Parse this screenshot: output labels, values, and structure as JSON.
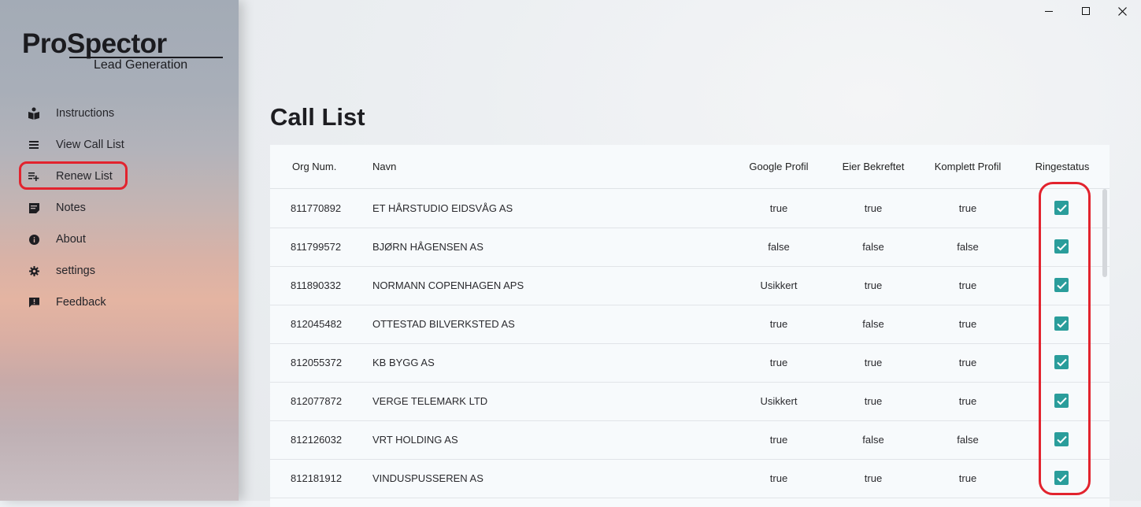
{
  "app": {
    "logo_title": "ProSpector",
    "logo_subtitle": "Lead Generation"
  },
  "sidebar": {
    "items": [
      {
        "label": "Instructions",
        "icon": "book-reader-icon"
      },
      {
        "label": "View Call List",
        "icon": "list-icon"
      },
      {
        "label": "Renew List",
        "icon": "playlist-add-icon"
      },
      {
        "label": "Notes",
        "icon": "note-icon"
      },
      {
        "label": "About",
        "icon": "info-icon"
      },
      {
        "label": "settings",
        "icon": "gear-icon"
      },
      {
        "label": "Feedback",
        "icon": "feedback-icon"
      }
    ]
  },
  "window": {
    "minimize": "minimize-icon",
    "maximize": "maximize-icon",
    "close": "close-icon"
  },
  "main": {
    "title": "Call List",
    "columns": [
      "Org Num.",
      "Navn",
      "Google Profil",
      "Eier Bekreftet",
      "Komplett Profil",
      "Ringestatus"
    ],
    "rows": [
      {
        "org": "811770892",
        "navn": "ET HÅRSTUDIO EIDSVÅG AS",
        "google": "true",
        "eier": "true",
        "komplett": "true",
        "ringestatus": true
      },
      {
        "org": "811799572",
        "navn": "BJØRN HÅGENSEN AS",
        "google": "false",
        "eier": "false",
        "komplett": "false",
        "ringestatus": true
      },
      {
        "org": "811890332",
        "navn": "NORMANN COPENHAGEN APS",
        "google": "Usikkert",
        "eier": "true",
        "komplett": "true",
        "ringestatus": true
      },
      {
        "org": "812045482",
        "navn": "OTTESTAD BILVERKSTED AS",
        "google": "true",
        "eier": "false",
        "komplett": "true",
        "ringestatus": true
      },
      {
        "org": "812055372",
        "navn": "KB BYGG AS",
        "google": "true",
        "eier": "true",
        "komplett": "true",
        "ringestatus": true
      },
      {
        "org": "812077872",
        "navn": "VERGE TELEMARK LTD",
        "google": "Usikkert",
        "eier": "true",
        "komplett": "true",
        "ringestatus": true
      },
      {
        "org": "812126032",
        "navn": "VRT HOLDING AS",
        "google": "true",
        "eier": "false",
        "komplett": "false",
        "ringestatus": true
      },
      {
        "org": "812181912",
        "navn": "VINDUSPUSSEREN AS",
        "google": "true",
        "eier": "true",
        "komplett": "true",
        "ringestatus": true
      }
    ]
  },
  "colors": {
    "accent": "#2a9d9b",
    "annotation": "#e2232e"
  }
}
